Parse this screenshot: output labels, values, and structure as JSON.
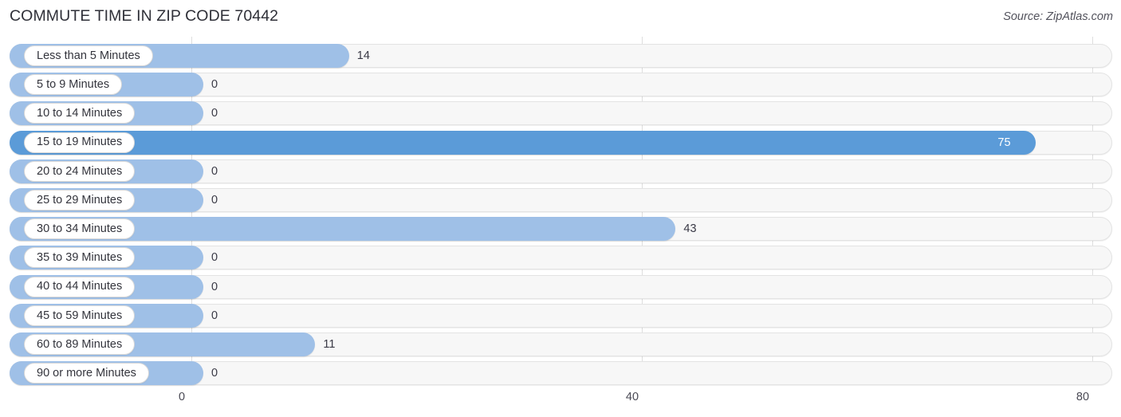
{
  "header": {
    "title": "COMMUTE TIME IN ZIP CODE 70442",
    "source": "Source: ZipAtlas.com"
  },
  "colors": {
    "bar_light": "#9fc0e7",
    "bar_highlight": "#5b9bd8",
    "track": "#f7f7f7",
    "gridline": "#dedede",
    "text": "#3a3a46",
    "value_in_bar": "#ffffff"
  },
  "chart_data": {
    "type": "bar",
    "orientation": "horizontal",
    "title": "COMMUTE TIME IN ZIP CODE 70442",
    "xlabel": "",
    "ylabel": "",
    "xlim": [
      0,
      80
    ],
    "xticks": [
      0,
      40,
      80
    ],
    "xtick_labels": [
      "0",
      "40",
      "80"
    ],
    "grid": true,
    "legend": false,
    "categories": [
      "Less than 5 Minutes",
      "5 to 9 Minutes",
      "10 to 14 Minutes",
      "15 to 19 Minutes",
      "20 to 24 Minutes",
      "25 to 29 Minutes",
      "30 to 34 Minutes",
      "35 to 39 Minutes",
      "40 to 44 Minutes",
      "45 to 59 Minutes",
      "60 to 89 Minutes",
      "90 or more Minutes"
    ],
    "values": [
      14,
      0,
      0,
      75,
      0,
      0,
      43,
      0,
      0,
      0,
      11,
      0
    ],
    "value_labels": [
      "14",
      "0",
      "0",
      "75",
      "0",
      "0",
      "43",
      "0",
      "0",
      "0",
      "11",
      "0"
    ],
    "highlight_index": 3
  },
  "rows": [
    {
      "label": "Less than 5 Minutes",
      "value": 14,
      "value_label": "14",
      "highlight": false
    },
    {
      "label": "5 to 9 Minutes",
      "value": 0,
      "value_label": "0",
      "highlight": false
    },
    {
      "label": "10 to 14 Minutes",
      "value": 0,
      "value_label": "0",
      "highlight": false
    },
    {
      "label": "15 to 19 Minutes",
      "value": 75,
      "value_label": "75",
      "highlight": true
    },
    {
      "label": "20 to 24 Minutes",
      "value": 0,
      "value_label": "0",
      "highlight": false
    },
    {
      "label": "25 to 29 Minutes",
      "value": 0,
      "value_label": "0",
      "highlight": false
    },
    {
      "label": "30 to 34 Minutes",
      "value": 43,
      "value_label": "43",
      "highlight": false
    },
    {
      "label": "35 to 39 Minutes",
      "value": 0,
      "value_label": "0",
      "highlight": false
    },
    {
      "label": "40 to 44 Minutes",
      "value": 0,
      "value_label": "0",
      "highlight": false
    },
    {
      "label": "45 to 59 Minutes",
      "value": 0,
      "value_label": "0",
      "highlight": false
    },
    {
      "label": "60 to 89 Minutes",
      "value": 11,
      "value_label": "11",
      "highlight": false
    },
    {
      "label": "90 or more Minutes",
      "value": 0,
      "value_label": "0",
      "highlight": false
    }
  ],
  "axis": {
    "ticks": [
      {
        "label": "0",
        "value": 0
      },
      {
        "label": "40",
        "value": 40
      },
      {
        "label": "80",
        "value": 80
      }
    ]
  }
}
